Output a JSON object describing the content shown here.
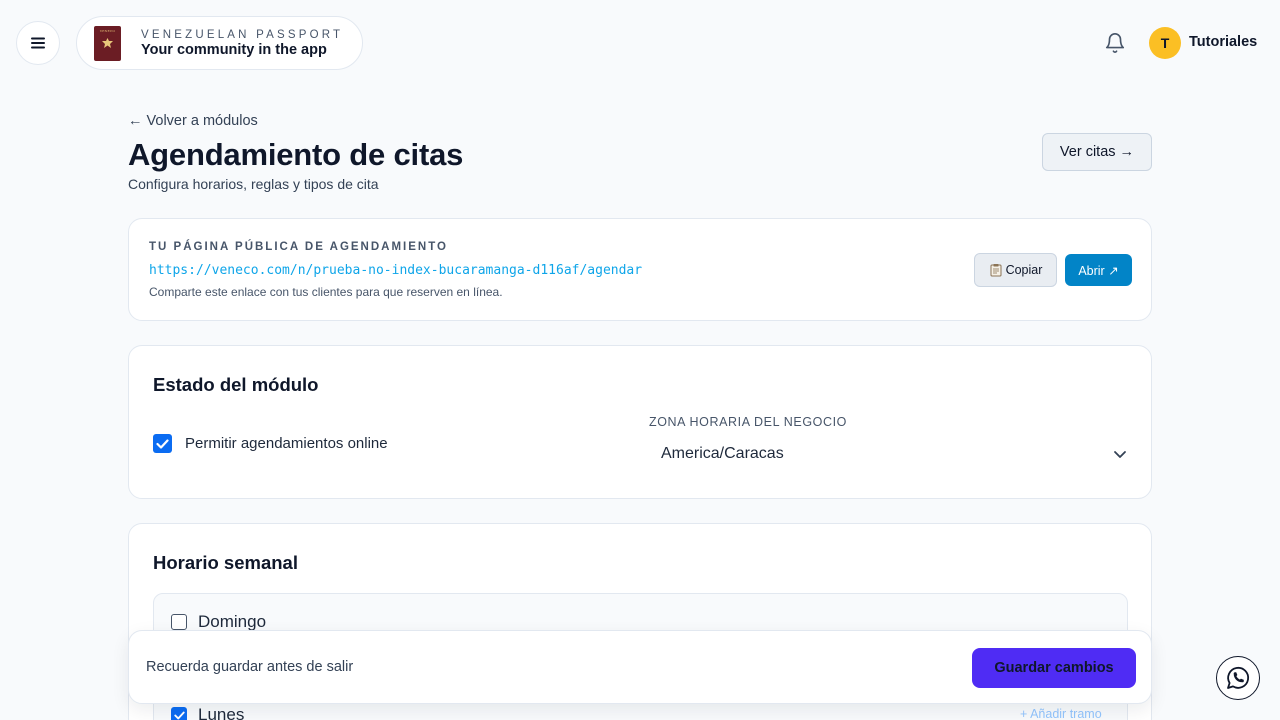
{
  "header": {
    "brand_top": "VENEZUELAN PASSPORT",
    "brand_bottom": "Your community in the app",
    "user_initial": "T",
    "user_name": "Tutoriales"
  },
  "page": {
    "back_link": "← Volver a módulos",
    "title": "Agendamiento de citas",
    "subtitle": "Configura horarios, reglas y tipos de cita",
    "view_appointments": "Ver citas →"
  },
  "public_page": {
    "label": "TU PÁGINA PÚBLICA DE AGENDAMIENTO",
    "url": "https://veneco.com/n/prueba-no-index-bucaramanga-d116af/agendar",
    "hint": "Comparte este enlace con tus clientes para que reserven en línea.",
    "copy_label": "Copiar",
    "open_label": "Abrir ↗"
  },
  "module_status": {
    "title": "Estado del módulo",
    "allow_online_label": "Permitir agendamientos online",
    "allow_online_checked": true,
    "timezone_label": "ZONA HORARIA DEL NEGOCIO",
    "timezone_value": "America/Caracas"
  },
  "weekly_schedule": {
    "title": "Horario semanal",
    "days": [
      {
        "name": "Domingo",
        "enabled": false
      },
      {
        "name": "Lunes",
        "enabled": true
      }
    ],
    "add_slot_label": "+ Añadir tramo"
  },
  "save_bar": {
    "reminder": "Recuerda guardar antes de salir",
    "save_label": "Guardar cambios"
  },
  "colors": {
    "primary_blue": "#0b6cf2",
    "open_button": "#0284c7",
    "save_button": "#4f2cf4",
    "avatar": "#fbbf24",
    "url_text": "#0ea5e9"
  }
}
